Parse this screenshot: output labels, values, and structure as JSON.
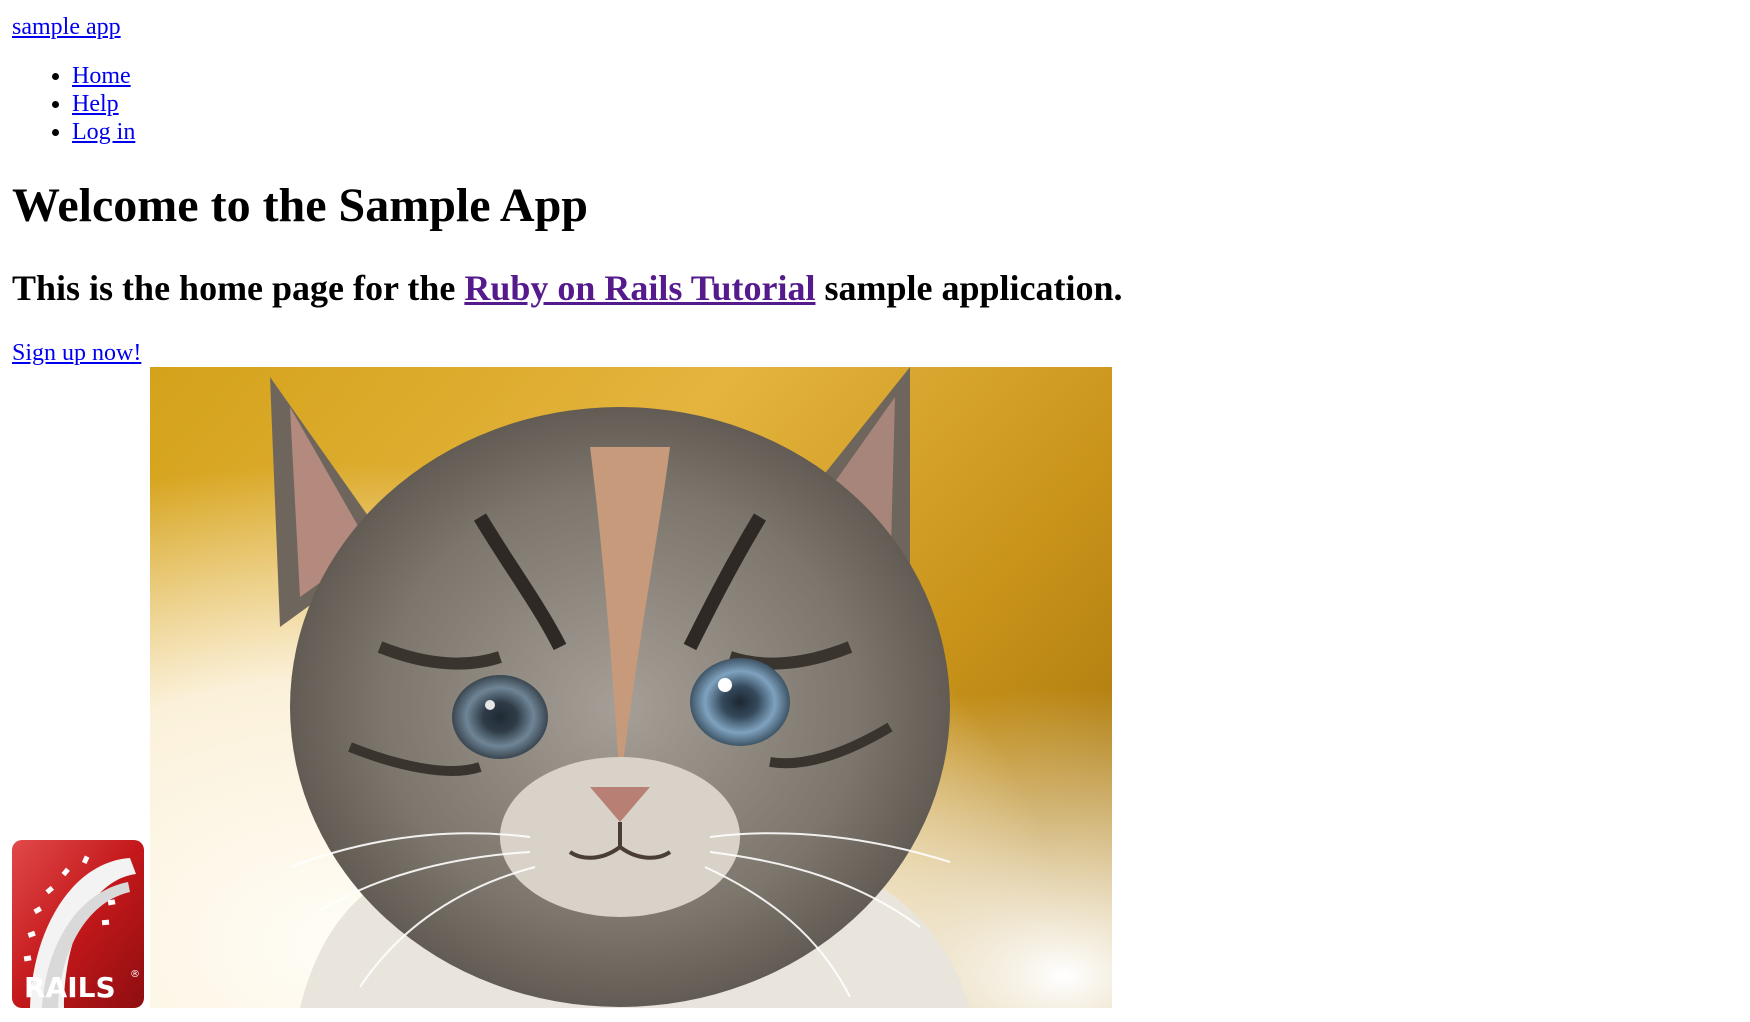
{
  "header": {
    "logo_text": "sample app",
    "nav": [
      {
        "label": "Home"
      },
      {
        "label": "Help"
      },
      {
        "label": "Log in"
      }
    ]
  },
  "main": {
    "title": "Welcome to the Sample App",
    "subtitle_prefix": "This is the home page for the ",
    "subtitle_link": "Ruby on Rails Tutorial",
    "subtitle_suffix": " sample application.",
    "signup_label": "Sign up now!"
  },
  "images": {
    "rails_logo_text": "RAILS",
    "rails_logo_color": "#c4181b",
    "kitten_background": "#d7a21c"
  }
}
